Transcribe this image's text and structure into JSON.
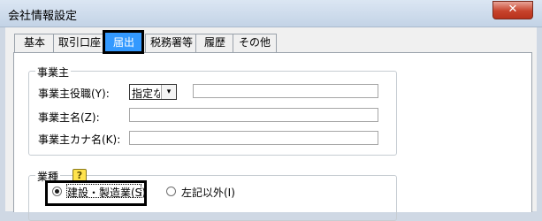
{
  "window": {
    "title": "会社情報設定",
    "close_glyph": "✕"
  },
  "tabs": [
    {
      "label": "基本"
    },
    {
      "label": "取引口座"
    },
    {
      "label": "届出"
    },
    {
      "label": "税務署等"
    },
    {
      "label": "履歴"
    },
    {
      "label": "その他"
    }
  ],
  "active_tab": "届出",
  "employer_group": {
    "title": "事業主",
    "fields": [
      {
        "label": "事業主役職(Y):",
        "value": ""
      },
      {
        "label": "事業主名(Z):",
        "value": ""
      },
      {
        "label": "事業主カナ名(K):",
        "value": ""
      }
    ],
    "title_select": {
      "value": "指定なし",
      "arrow": "▾"
    }
  },
  "industry_group": {
    "title": "業種",
    "help_glyph": "?",
    "options": [
      {
        "label": "建設・製造業(S)",
        "checked": true
      },
      {
        "label": "左記以外(I)",
        "checked": false
      }
    ]
  }
}
